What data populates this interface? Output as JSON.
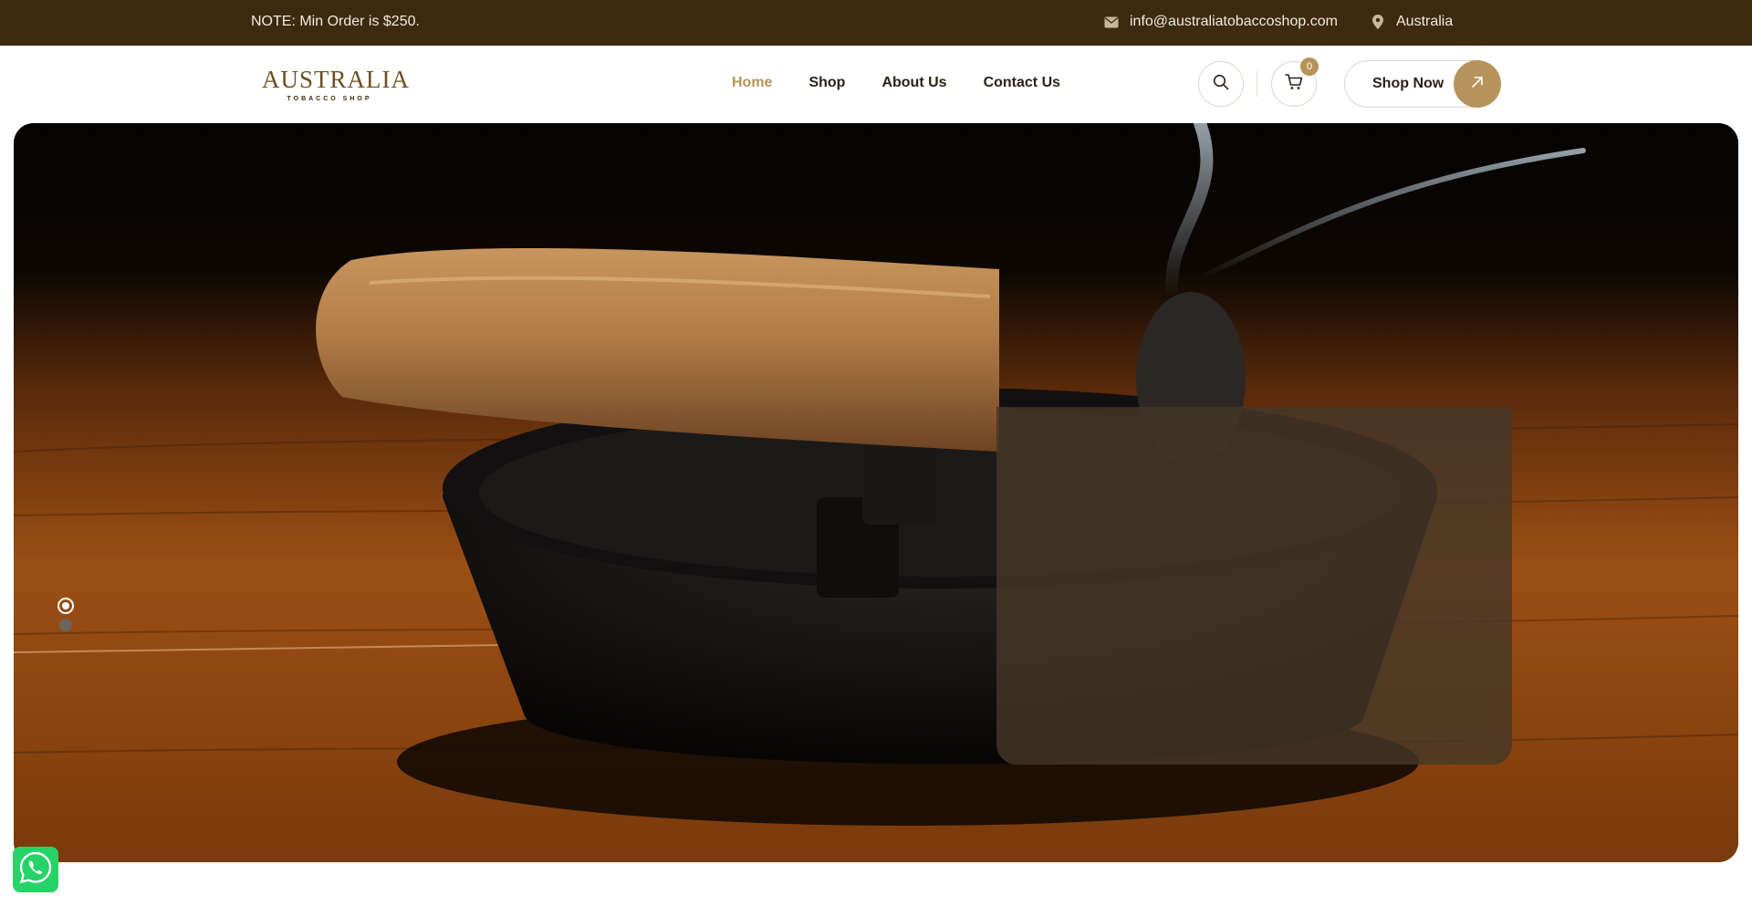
{
  "topbar": {
    "note": "NOTE: Min Order is $250.",
    "email": "info@australiatobaccoshop.com",
    "location": "Australia",
    "icons": {
      "email": "envelope-icon",
      "location": "map-pin-icon"
    }
  },
  "logo": {
    "main": "AUSTRALIA",
    "sub": "TOBACCO SHOP"
  },
  "nav": {
    "items": [
      {
        "label": "Home",
        "active": true
      },
      {
        "label": "Shop",
        "active": false
      },
      {
        "label": "About Us",
        "active": false
      },
      {
        "label": "Contact Us",
        "active": false
      }
    ]
  },
  "header_actions": {
    "search_icon": "search-icon",
    "cart_icon": "cart-icon",
    "cart_count": "0",
    "shop_now_label": "Shop Now",
    "arrow_icon": "arrow-up-right-icon"
  },
  "hero": {
    "image": "cigar-on-ashtray-photo",
    "slide_count": 2,
    "active_slide": 1
  },
  "colors": {
    "topbar_bg": "#3d2a0f",
    "accent": "#b6935a",
    "text_dark": "#2b2117",
    "whatsapp": "#25d366"
  },
  "floating": {
    "whatsapp_icon": "whatsapp-icon"
  }
}
